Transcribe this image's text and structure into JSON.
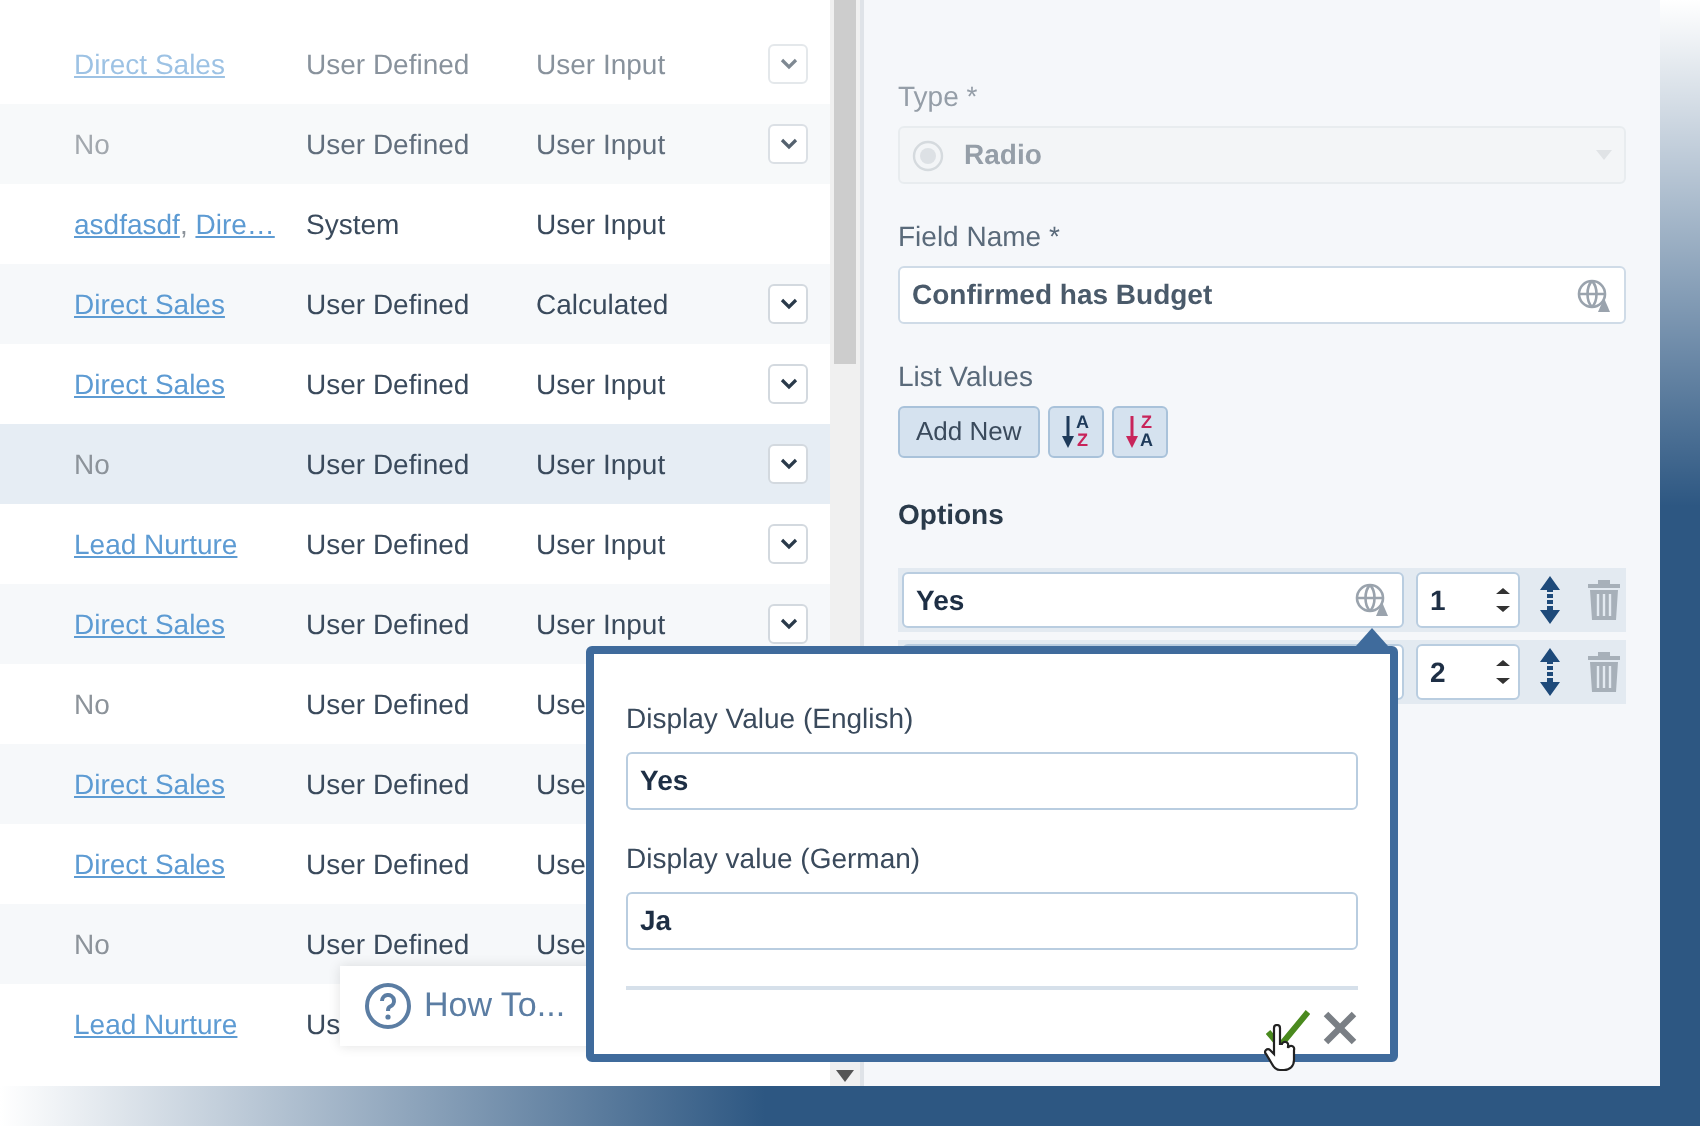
{
  "table": {
    "rows": [
      {
        "column_1": {
          "links": [
            "Direct Sales"
          ]
        },
        "column_2": "User Defined",
        "column_3": "User Input",
        "menu_button": true,
        "selected": false
      },
      {
        "column_1": {
          "text": "No"
        },
        "column_2": "User Defined",
        "column_3": "User Input",
        "menu_button": true,
        "selected": false
      },
      {
        "column_1": {
          "links": [
            "asdfasdf",
            "Dire…"
          ],
          "separator": ","
        },
        "column_2": "System",
        "column_3": "User Input",
        "menu_button": false,
        "selected": false
      },
      {
        "column_1": {
          "links": [
            "Direct Sales"
          ]
        },
        "column_2": "User Defined",
        "column_3": "Calculated",
        "menu_button": true,
        "selected": false
      },
      {
        "column_1": {
          "links": [
            "Direct Sales"
          ]
        },
        "column_2": "User Defined",
        "column_3": "User Input",
        "menu_button": true,
        "selected": false
      },
      {
        "column_1": {
          "text": "No"
        },
        "column_2": "User Defined",
        "column_3": "User Input",
        "menu_button": true,
        "selected": true
      },
      {
        "column_1": {
          "links": [
            "Lead Nurture"
          ]
        },
        "column_2": "User Defined",
        "column_3": "User Input",
        "menu_button": true,
        "selected": false
      },
      {
        "column_1": {
          "links": [
            "Direct Sales"
          ]
        },
        "column_2": "User Defined",
        "column_3": "User Input",
        "menu_button": true,
        "selected": false
      },
      {
        "column_1": {
          "text": "No"
        },
        "column_2": "User Defined",
        "column_3": "Use",
        "menu_button": false,
        "selected": false
      },
      {
        "column_1": {
          "links": [
            "Direct Sales"
          ]
        },
        "column_2": "User Defined",
        "column_3": "Use",
        "menu_button": false,
        "selected": false
      },
      {
        "column_1": {
          "links": [
            "Direct Sales"
          ]
        },
        "column_2": "User Defined",
        "column_3": "Use",
        "menu_button": false,
        "selected": false
      },
      {
        "column_1": {
          "text": "No"
        },
        "column_2": "User Defined",
        "column_3": "Use",
        "menu_button": false,
        "selected": false
      },
      {
        "column_1": {
          "links": [
            "Lead Nurture"
          ]
        },
        "column_2": "Us",
        "menu_button": false,
        "selected": false
      }
    ]
  },
  "how_to": {
    "label": "How To..."
  },
  "form": {
    "type_field": {
      "label": "Type *",
      "value": "Radio",
      "disabled": true
    },
    "field_name": {
      "label": "Field Name *",
      "value": "Confirmed has Budget"
    },
    "list_values": {
      "label": "List Values",
      "add_button": "Add New",
      "sort_buttons": [
        {
          "kind": "ascending",
          "upper": "A",
          "lower": "Z"
        },
        {
          "kind": "descending",
          "upper": "Z",
          "lower": "A"
        }
      ]
    },
    "options": {
      "title": "Options",
      "rows": [
        {
          "value": "Yes",
          "order": "1"
        },
        {
          "order": "2"
        }
      ]
    }
  },
  "popover": {
    "fields": [
      {
        "label": "Display Value (English)",
        "value": "Yes"
      },
      {
        "label": "Display value (German)",
        "value": "Ja"
      }
    ]
  }
}
